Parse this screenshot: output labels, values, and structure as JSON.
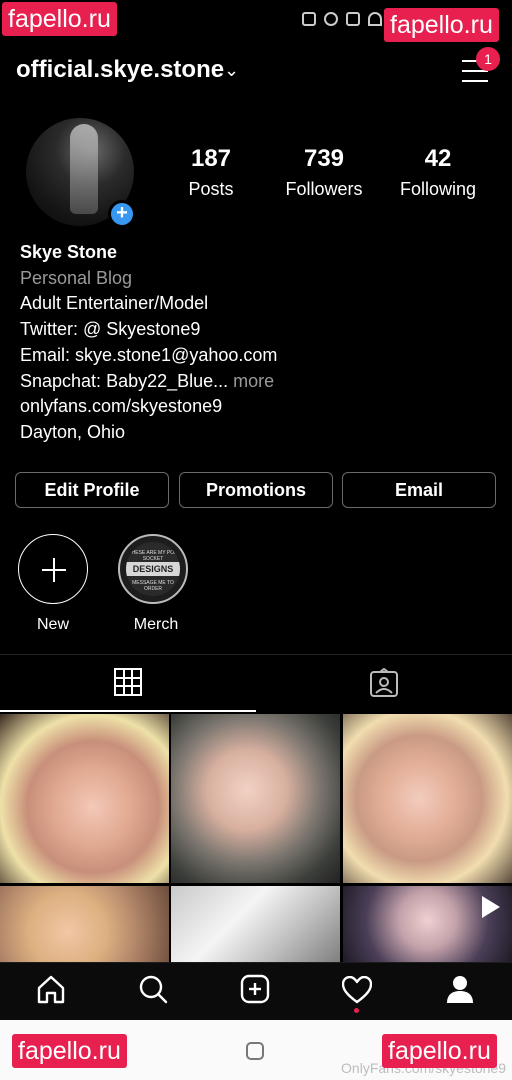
{
  "watermark": {
    "text": "fapello.ru",
    "source_text": "OnlyFans.com/skyestone9"
  },
  "header": {
    "username": "official.skye.stone",
    "chevron": "⌄",
    "notification_count": "1"
  },
  "stats": [
    {
      "value": "187",
      "label": "Posts"
    },
    {
      "value": "739",
      "label": "Followers"
    },
    {
      "value": "42",
      "label": "Following"
    }
  ],
  "bio": {
    "name": "Skye Stone",
    "category": "Personal Blog",
    "lines": [
      "Adult Entertainer/Model",
      "Twitter: @ Skyestone9",
      "Email: skye.stone1@yahoo.com",
      "Snapchat: Baby22_Blue..."
    ],
    "more": " more",
    "link": "onlyfans.com/skyestone9",
    "location": "Dayton, Ohio"
  },
  "buttons": {
    "edit_profile": "Edit Profile",
    "promotions": "Promotions",
    "email": "Email"
  },
  "highlights": [
    {
      "label": "New"
    },
    {
      "label": "Merch",
      "band_text": "DESIGNS",
      "top_text": "THESE ARE MY POP SOCKET",
      "bottom_text": "MESSAGE ME TO ORDER"
    }
  ],
  "tabs": {
    "active": "grid"
  },
  "icons": {
    "home": "home-icon",
    "search": "search-icon",
    "add": "add-post-icon",
    "activity": "heart-icon",
    "profile": "profile-icon",
    "grid": "grid-icon",
    "tagged": "tagged-icon"
  },
  "colors": {
    "accent": "#e8204f",
    "badge": "#3897f0",
    "background": "#000000"
  }
}
